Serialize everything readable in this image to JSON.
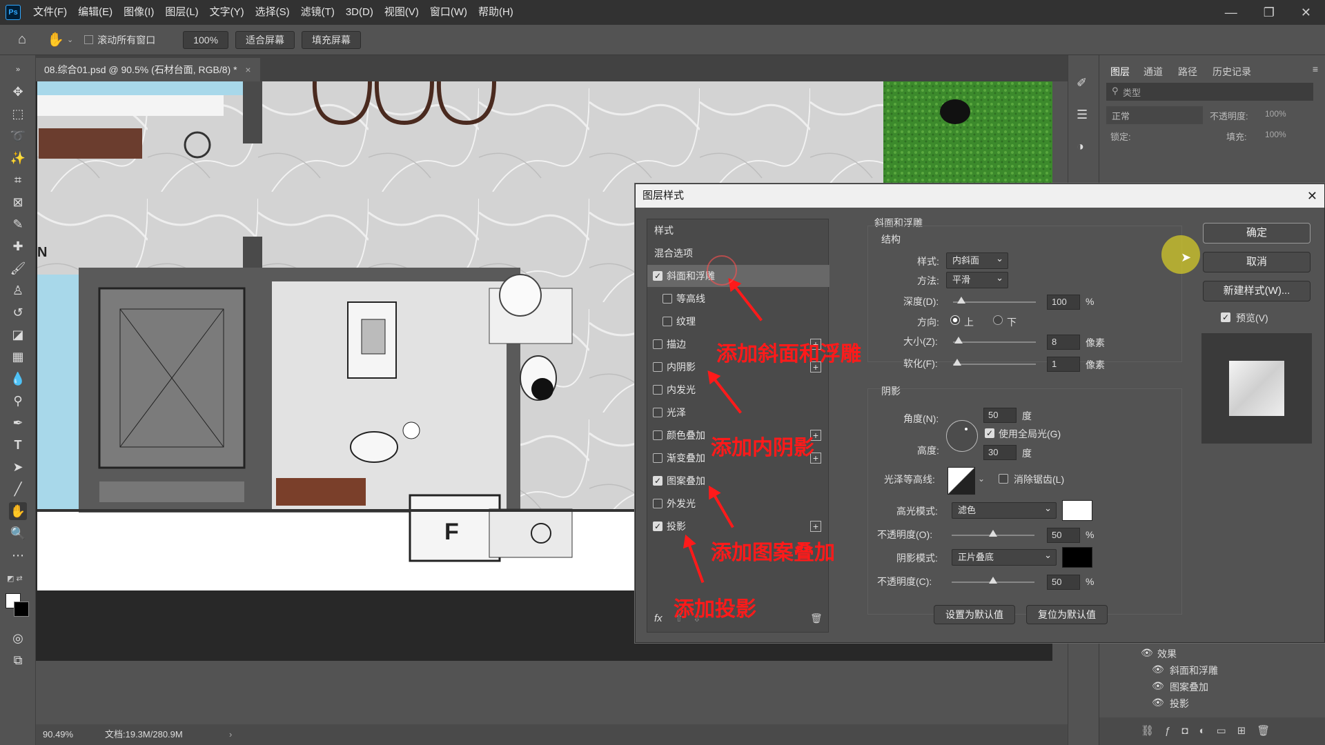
{
  "app": {
    "logo": "Ps"
  },
  "menu": [
    "文件(F)",
    "编辑(E)",
    "图像(I)",
    "图层(L)",
    "文字(Y)",
    "选择(S)",
    "滤镜(T)",
    "3D(D)",
    "视图(V)",
    "窗口(W)",
    "帮助(H)"
  ],
  "options": {
    "scroll_all": "滚动所有窗口",
    "zoom": "100%",
    "fit_screen": "适合屏幕",
    "fill_screen": "填充屏幕"
  },
  "document": {
    "tab_title": "08.综合01.psd @ 90.5% (石材台面, RGB/8) *",
    "zoom_status": "90.49%",
    "doc_size": "文档:19.3M/280.9M",
    "room_letter": "F",
    "edge_text": "N"
  },
  "panels": {
    "tabs": [
      "图层",
      "通道",
      "路径",
      "历史记录"
    ],
    "search_placeholder": "类型",
    "blend_mode": "正常",
    "opacity_label": "不透明度:",
    "opacity_value": "100%",
    "lock_label": "锁定:",
    "fill_label": "填充:",
    "fill_value": "100%",
    "effects_label": "效果",
    "effects": [
      "斜面和浮雕",
      "图案叠加",
      "投影"
    ]
  },
  "dialog": {
    "title": "图层样式",
    "styles_header": "样式",
    "blend_options": "混合选项",
    "styles": [
      {
        "label": "斜面和浮雕",
        "checked": true,
        "plus": false,
        "selected": true,
        "indent": false
      },
      {
        "label": "等高线",
        "checked": false,
        "plus": false,
        "selected": false,
        "indent": true
      },
      {
        "label": "纹理",
        "checked": false,
        "plus": false,
        "selected": false,
        "indent": true
      },
      {
        "label": "描边",
        "checked": false,
        "plus": true,
        "selected": false,
        "indent": false
      },
      {
        "label": "内阴影",
        "checked": false,
        "plus": true,
        "selected": false,
        "indent": false
      },
      {
        "label": "内发光",
        "checked": false,
        "plus": false,
        "selected": false,
        "indent": false
      },
      {
        "label": "光泽",
        "checked": false,
        "plus": false,
        "selected": false,
        "indent": false
      },
      {
        "label": "颜色叠加",
        "checked": false,
        "plus": true,
        "selected": false,
        "indent": false
      },
      {
        "label": "渐变叠加",
        "checked": false,
        "plus": true,
        "selected": false,
        "indent": false
      },
      {
        "label": "图案叠加",
        "checked": true,
        "plus": false,
        "selected": false,
        "indent": false
      },
      {
        "label": "外发光",
        "checked": false,
        "plus": false,
        "selected": false,
        "indent": false
      },
      {
        "label": "投影",
        "checked": true,
        "plus": true,
        "selected": false,
        "indent": false
      }
    ],
    "fx": "fx",
    "section_title": "斜面和浮雕",
    "structure": {
      "title": "结构",
      "style_label": "样式:",
      "style_value": "内斜面",
      "method_label": "方法:",
      "method_value": "平滑",
      "depth_label": "深度(D):",
      "depth_value": "100",
      "depth_unit": "%",
      "direction_label": "方向:",
      "dir_up": "上",
      "dir_down": "下",
      "size_label": "大小(Z):",
      "size_value": "8",
      "size_unit": "像素",
      "soften_label": "软化(F):",
      "soften_value": "1",
      "soften_unit": "像素"
    },
    "shading": {
      "title": "阴影",
      "angle_label": "角度(N):",
      "angle_value": "50",
      "angle_unit": "度",
      "global_light": "使用全局光(G)",
      "altitude_label": "高度:",
      "altitude_value": "30",
      "altitude_unit": "度",
      "gloss_label": "光泽等高线:",
      "antialias": "消除锯齿(L)",
      "highlight_label": "高光模式:",
      "highlight_mode": "滤色",
      "hl_opacity_label": "不透明度(O):",
      "hl_opacity": "50",
      "hl_unit": "%",
      "shadow_label": "阴影模式:",
      "shadow_mode": "正片叠底",
      "sh_opacity_label": "不透明度(C):",
      "sh_opacity": "50",
      "sh_unit": "%"
    },
    "make_default": "设置为默认值",
    "reset_default": "复位为默认值",
    "ok": "确定",
    "cancel": "取消",
    "new_style": "新建样式(W)...",
    "preview": "预览(V)",
    "colors": {
      "highlight": "#ffffff",
      "shadow": "#000000"
    }
  },
  "annotations": {
    "a1": "添加斜面和浮雕",
    "a2": "添加内阴影",
    "a3": "添加图案叠加",
    "a4": "添加投影",
    "color": "#ff1a1a"
  }
}
